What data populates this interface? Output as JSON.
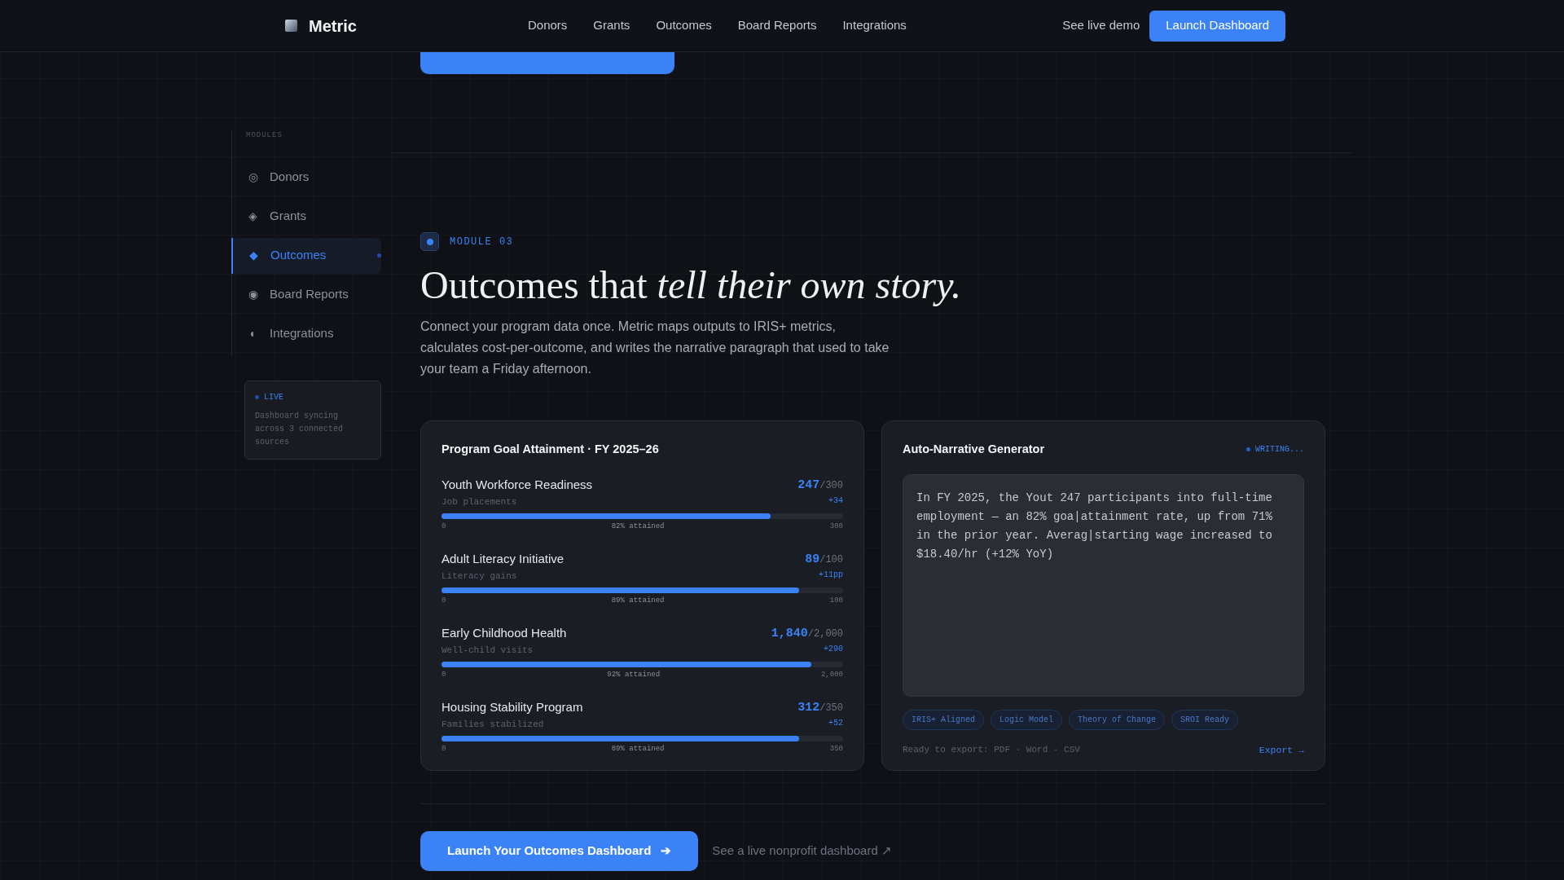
{
  "nav": {
    "brand": "Metric",
    "links": [
      "Donors",
      "Grants",
      "Outcomes",
      "Board Reports",
      "Integrations"
    ],
    "demo_link": "See live demo",
    "cta": "Launch Dashboard"
  },
  "sidebar": {
    "heading": "MODULES",
    "items": [
      {
        "icon": "◎",
        "label": "Donors",
        "selected": false
      },
      {
        "icon": "◈",
        "label": "Grants",
        "selected": false
      },
      {
        "icon": "◆",
        "label": "Outcomes",
        "selected": true
      },
      {
        "icon": "◉",
        "label": "Board Reports",
        "selected": false
      },
      {
        "icon": "◖",
        "label": "Integrations",
        "selected": false
      }
    ],
    "status": {
      "label": "LIVE",
      "text": "Dashboard syncing across 3 connected sources"
    }
  },
  "module": {
    "eyebrow": "MODULE 03",
    "heading": "Outcomes that *tell their own story.*",
    "description": "Connect your program data once. Metric maps outputs to IRIS+ metrics, calculates cost-per-outcome, and writes the narrative paragraph that used to take your team a Friday afternoon."
  },
  "goal_card": {
    "title": "Program Goal Attainment · FY 2025–26",
    "programs": [
      {
        "name": "Youth Workforce Readiness",
        "metric": "Job placements",
        "value": "247",
        "target": "/300",
        "delta": "+34",
        "level": 0.82,
        "min": "0",
        "attained": "82% attained",
        "max": "300"
      },
      {
        "name": "Adult Literacy Initiative",
        "metric": "Literacy gains",
        "value": "89",
        "target": "/100",
        "delta": "+11pp",
        "level": 0.89,
        "min": "0",
        "attained": "89% attained",
        "max": "100"
      },
      {
        "name": "Early Childhood Health",
        "metric": "Well-child visits",
        "value": "1,840",
        "target": "/2,000",
        "delta": "+290",
        "level": 0.92,
        "min": "0",
        "attained": "92% attained",
        "max": "2,000"
      },
      {
        "name": "Housing Stability Program",
        "metric": "Families stabilized",
        "value": "312",
        "target": "/350",
        "delta": "+52",
        "level": 0.89,
        "min": "0",
        "attained": "89% attained",
        "max": "350"
      }
    ]
  },
  "narrative_card": {
    "title": "Auto-Narrative Generator",
    "status": "WRITING...",
    "text": "In FY 2025, the Yout 247 participants into full-time employment — an 82% goa|attainment rate, up from 71% in the prior year. Averag|starting wage increased to $18.40/hr (+12% YoY)",
    "tags": [
      "IRIS+ Aligned",
      "Logic Model",
      "Theory of Change",
      "SROI Ready"
    ],
    "export_note": "Ready to export: PDF · Word · CSV",
    "export_link": "Export →"
  },
  "next_section": {
    "button": "Launch Your Outcomes Dashboard",
    "arrow": "➔",
    "link": "See a live nonprofit dashboard ↗"
  }
}
